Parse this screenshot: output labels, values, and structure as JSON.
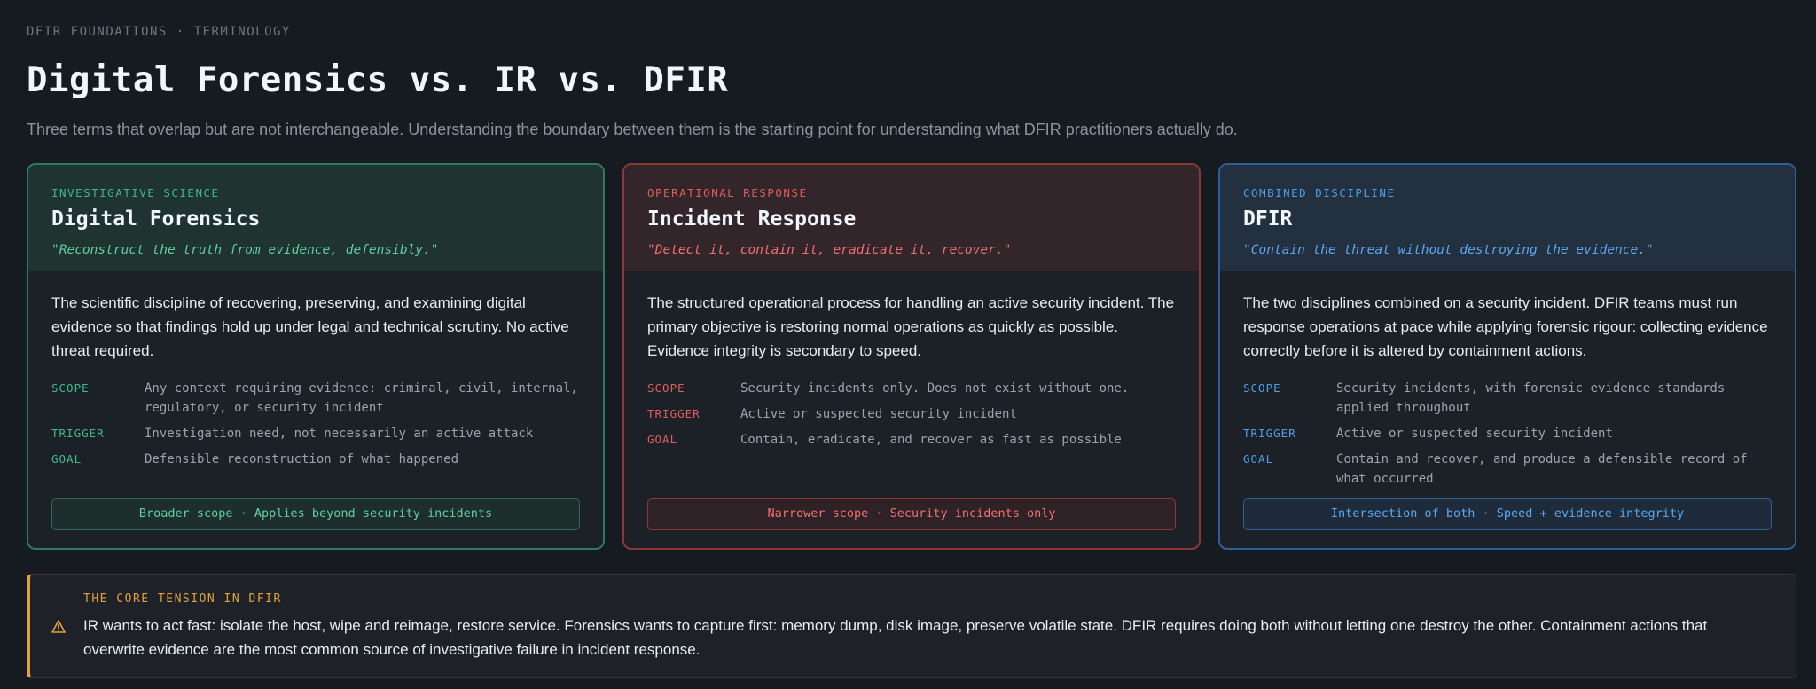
{
  "header": {
    "eyebrow": "DFIR FOUNDATIONS · TERMINOLOGY",
    "title": "Digital Forensics vs. IR vs. DFIR",
    "subtitle": "Three terms that overlap but are not interchangeable. Understanding the boundary between them is the starting point for understanding what DFIR practitioners actually do."
  },
  "cards": [
    {
      "kicker": "INVESTIGATIVE SCIENCE",
      "title": "Digital Forensics",
      "quote": "\"Reconstruct the truth from evidence, defensibly.\"",
      "description": "The scientific discipline of recovering, preserving, and examining digital evidence so that findings hold up under legal and technical scrutiny. No active threat required.",
      "rows": [
        {
          "key": "SCOPE",
          "value": "Any context requiring evidence: criminal, civil, internal, regulatory, or security incident"
        },
        {
          "key": "TRIGGER",
          "value": "Investigation need, not necessarily an active attack"
        },
        {
          "key": "GOAL",
          "value": "Defensible reconstruction of what happened"
        }
      ],
      "footer": "Broader scope · Applies beyond security incidents",
      "accent": "#3fb98a"
    },
    {
      "kicker": "OPERATIONAL RESPONSE",
      "title": "Incident Response",
      "quote": "\"Detect it, contain it, eradicate it, recover.\"",
      "description": "The structured operational process for handling an active security incident. The primary objective is restoring normal operations as quickly as possible. Evidence integrity is secondary to speed.",
      "rows": [
        {
          "key": "SCOPE",
          "value": "Security incidents only. Does not exist without one."
        },
        {
          "key": "TRIGGER",
          "value": "Active or suspected security incident"
        },
        {
          "key": "GOAL",
          "value": "Contain, eradicate, and recover as fast as possible"
        }
      ],
      "footer": "Narrower scope · Security incidents only",
      "accent": "#e05d5d"
    },
    {
      "kicker": "COMBINED DISCIPLINE",
      "title": "DFIR",
      "quote": "\"Contain the threat without destroying the evidence.\"",
      "description": "The two disciplines combined on a security incident. DFIR teams must run response operations at pace while applying forensic rigour: collecting evidence correctly before it is altered by containment actions.",
      "rows": [
        {
          "key": "SCOPE",
          "value": "Security incidents, with forensic evidence standards applied throughout"
        },
        {
          "key": "TRIGGER",
          "value": "Active or suspected security incident"
        },
        {
          "key": "GOAL",
          "value": "Contain and recover, and produce a defensible record of what occurred"
        }
      ],
      "footer": "Intersection of both · Speed + evidence integrity",
      "accent": "#4f9ee8"
    }
  ],
  "callout": {
    "icon": "warning-icon",
    "kicker": "THE CORE TENSION IN DFIR",
    "text": "IR wants to act fast: isolate the host, wipe and reimage, restore service. Forensics wants to capture first: memory dump, disk image, preserve volatile state. DFIR requires doing both without letting one destroy the other. Containment actions that overwrite evidence are the most common source of investigative failure in incident response.",
    "accent": "#e3a33a"
  }
}
